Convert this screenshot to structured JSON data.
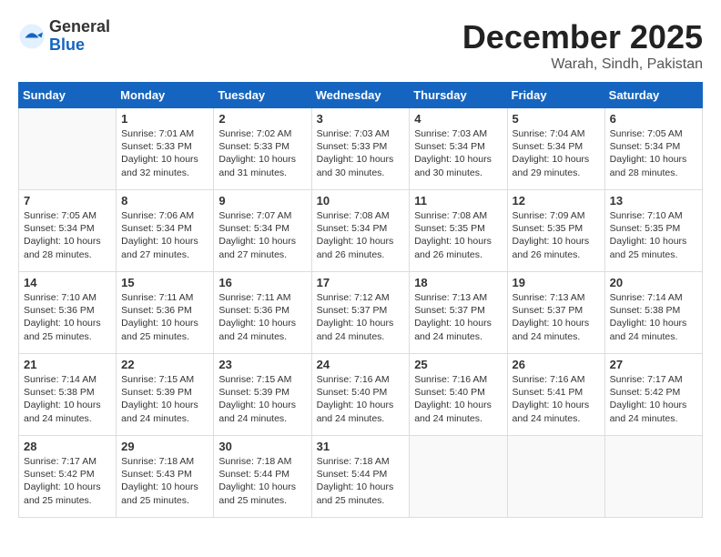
{
  "logo": {
    "general": "General",
    "blue": "Blue"
  },
  "title": "December 2025",
  "location": "Warah, Sindh, Pakistan",
  "weekdays": [
    "Sunday",
    "Monday",
    "Tuesday",
    "Wednesday",
    "Thursday",
    "Friday",
    "Saturday"
  ],
  "weeks": [
    [
      {
        "day": "",
        "info": ""
      },
      {
        "day": "1",
        "info": "Sunrise: 7:01 AM\nSunset: 5:33 PM\nDaylight: 10 hours\nand 32 minutes."
      },
      {
        "day": "2",
        "info": "Sunrise: 7:02 AM\nSunset: 5:33 PM\nDaylight: 10 hours\nand 31 minutes."
      },
      {
        "day": "3",
        "info": "Sunrise: 7:03 AM\nSunset: 5:33 PM\nDaylight: 10 hours\nand 30 minutes."
      },
      {
        "day": "4",
        "info": "Sunrise: 7:03 AM\nSunset: 5:34 PM\nDaylight: 10 hours\nand 30 minutes."
      },
      {
        "day": "5",
        "info": "Sunrise: 7:04 AM\nSunset: 5:34 PM\nDaylight: 10 hours\nand 29 minutes."
      },
      {
        "day": "6",
        "info": "Sunrise: 7:05 AM\nSunset: 5:34 PM\nDaylight: 10 hours\nand 28 minutes."
      }
    ],
    [
      {
        "day": "7",
        "info": "Sunrise: 7:05 AM\nSunset: 5:34 PM\nDaylight: 10 hours\nand 28 minutes."
      },
      {
        "day": "8",
        "info": "Sunrise: 7:06 AM\nSunset: 5:34 PM\nDaylight: 10 hours\nand 27 minutes."
      },
      {
        "day": "9",
        "info": "Sunrise: 7:07 AM\nSunset: 5:34 PM\nDaylight: 10 hours\nand 27 minutes."
      },
      {
        "day": "10",
        "info": "Sunrise: 7:08 AM\nSunset: 5:34 PM\nDaylight: 10 hours\nand 26 minutes."
      },
      {
        "day": "11",
        "info": "Sunrise: 7:08 AM\nSunset: 5:35 PM\nDaylight: 10 hours\nand 26 minutes."
      },
      {
        "day": "12",
        "info": "Sunrise: 7:09 AM\nSunset: 5:35 PM\nDaylight: 10 hours\nand 26 minutes."
      },
      {
        "day": "13",
        "info": "Sunrise: 7:10 AM\nSunset: 5:35 PM\nDaylight: 10 hours\nand 25 minutes."
      }
    ],
    [
      {
        "day": "14",
        "info": "Sunrise: 7:10 AM\nSunset: 5:36 PM\nDaylight: 10 hours\nand 25 minutes."
      },
      {
        "day": "15",
        "info": "Sunrise: 7:11 AM\nSunset: 5:36 PM\nDaylight: 10 hours\nand 25 minutes."
      },
      {
        "day": "16",
        "info": "Sunrise: 7:11 AM\nSunset: 5:36 PM\nDaylight: 10 hours\nand 24 minutes."
      },
      {
        "day": "17",
        "info": "Sunrise: 7:12 AM\nSunset: 5:37 PM\nDaylight: 10 hours\nand 24 minutes."
      },
      {
        "day": "18",
        "info": "Sunrise: 7:13 AM\nSunset: 5:37 PM\nDaylight: 10 hours\nand 24 minutes."
      },
      {
        "day": "19",
        "info": "Sunrise: 7:13 AM\nSunset: 5:37 PM\nDaylight: 10 hours\nand 24 minutes."
      },
      {
        "day": "20",
        "info": "Sunrise: 7:14 AM\nSunset: 5:38 PM\nDaylight: 10 hours\nand 24 minutes."
      }
    ],
    [
      {
        "day": "21",
        "info": "Sunrise: 7:14 AM\nSunset: 5:38 PM\nDaylight: 10 hours\nand 24 minutes."
      },
      {
        "day": "22",
        "info": "Sunrise: 7:15 AM\nSunset: 5:39 PM\nDaylight: 10 hours\nand 24 minutes."
      },
      {
        "day": "23",
        "info": "Sunrise: 7:15 AM\nSunset: 5:39 PM\nDaylight: 10 hours\nand 24 minutes."
      },
      {
        "day": "24",
        "info": "Sunrise: 7:16 AM\nSunset: 5:40 PM\nDaylight: 10 hours\nand 24 minutes."
      },
      {
        "day": "25",
        "info": "Sunrise: 7:16 AM\nSunset: 5:40 PM\nDaylight: 10 hours\nand 24 minutes."
      },
      {
        "day": "26",
        "info": "Sunrise: 7:16 AM\nSunset: 5:41 PM\nDaylight: 10 hours\nand 24 minutes."
      },
      {
        "day": "27",
        "info": "Sunrise: 7:17 AM\nSunset: 5:42 PM\nDaylight: 10 hours\nand 24 minutes."
      }
    ],
    [
      {
        "day": "28",
        "info": "Sunrise: 7:17 AM\nSunset: 5:42 PM\nDaylight: 10 hours\nand 25 minutes."
      },
      {
        "day": "29",
        "info": "Sunrise: 7:18 AM\nSunset: 5:43 PM\nDaylight: 10 hours\nand 25 minutes."
      },
      {
        "day": "30",
        "info": "Sunrise: 7:18 AM\nSunset: 5:44 PM\nDaylight: 10 hours\nand 25 minutes."
      },
      {
        "day": "31",
        "info": "Sunrise: 7:18 AM\nSunset: 5:44 PM\nDaylight: 10 hours\nand 25 minutes."
      },
      {
        "day": "",
        "info": ""
      },
      {
        "day": "",
        "info": ""
      },
      {
        "day": "",
        "info": ""
      }
    ]
  ]
}
